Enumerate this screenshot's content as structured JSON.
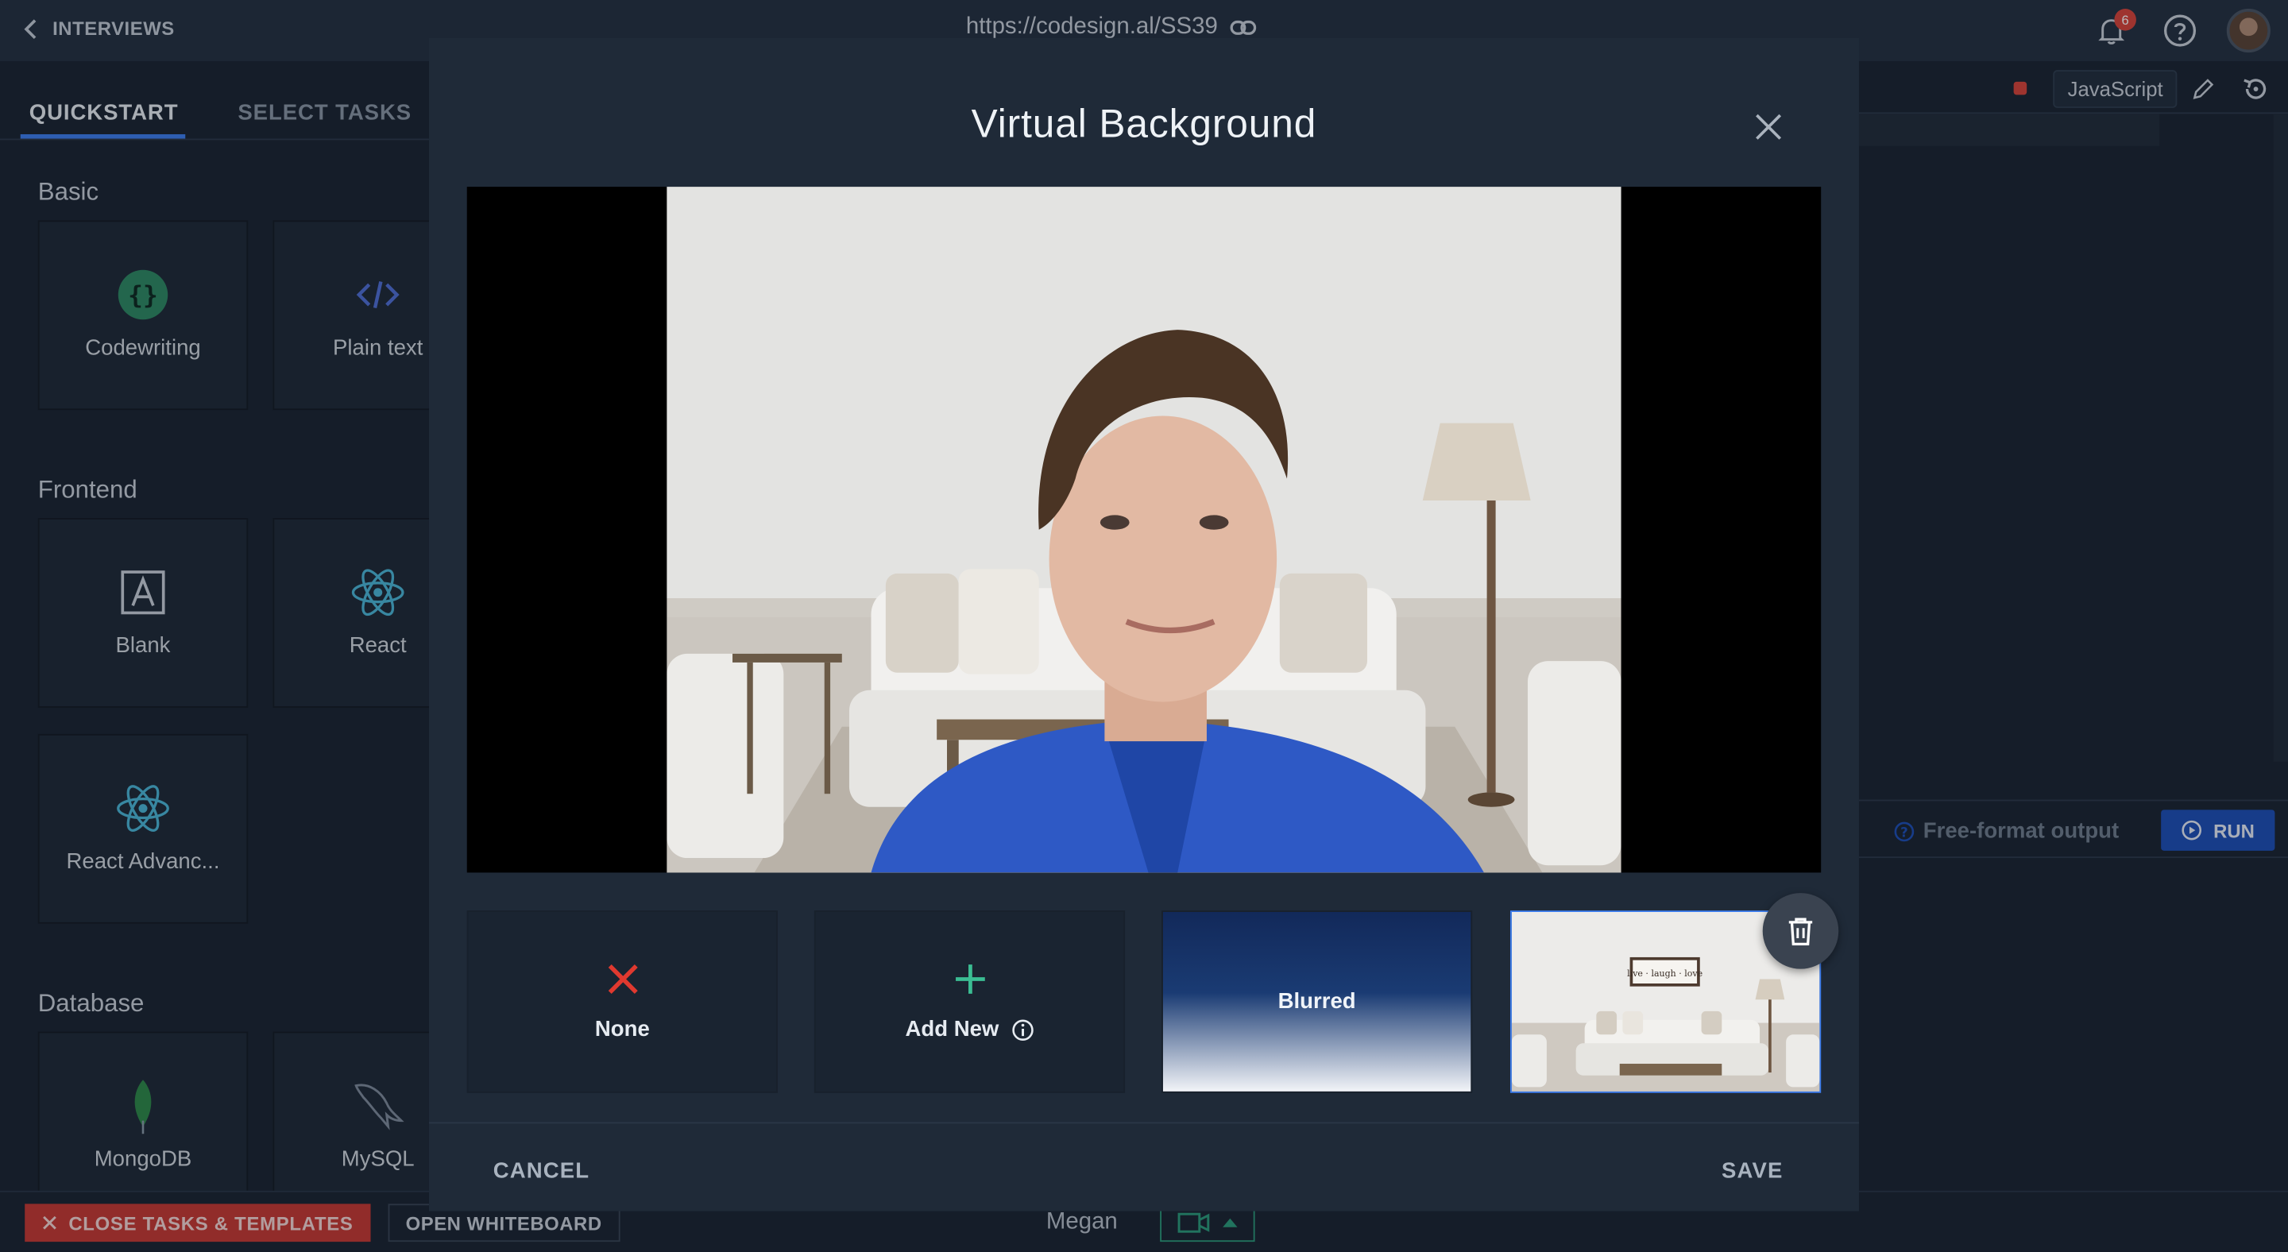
{
  "topbar": {
    "back_label": "INTERVIEWS",
    "url": "https://codesign.al/SS39",
    "notifications_count": "6"
  },
  "left_panel": {
    "tabs": [
      {
        "label": "QUICKSTART",
        "active": true
      },
      {
        "label": "SELECT TASKS",
        "active": false
      }
    ],
    "sections": [
      {
        "title": "Basic",
        "cards": [
          {
            "label": "Codewriting",
            "icon": "code-braces-icon"
          },
          {
            "label": "Plain text",
            "icon": "code-tag-icon"
          }
        ]
      },
      {
        "title": "Frontend",
        "cards": [
          {
            "label": "Blank",
            "icon": "blank-a-icon"
          },
          {
            "label": "React",
            "icon": "react-atom-icon"
          },
          {
            "label": "React Advanc...",
            "icon": "react-atom-icon"
          }
        ]
      },
      {
        "title": "Database",
        "cards": [
          {
            "label": "MongoDB",
            "icon": "mongodb-leaf-icon"
          },
          {
            "label": "MySQL",
            "icon": "mysql-dolphin-icon"
          }
        ]
      }
    ]
  },
  "right_area": {
    "language": "JavaScript",
    "output_label": "Free-format output",
    "run_label": "RUN"
  },
  "bottombar": {
    "close_label": "CLOSE TASKS & TEMPLATES",
    "whiteboard_label": "OPEN WHITEBOARD",
    "user_name": "Megan"
  },
  "modal": {
    "title": "Virtual Background",
    "options": [
      {
        "label": "None",
        "icon": "x-icon"
      },
      {
        "label": "Add New",
        "icon": "plus-icon"
      },
      {
        "label": "Blurred"
      },
      {
        "label": "",
        "sign_text": "live · laugh · love",
        "selected": true
      }
    ],
    "cancel_label": "CANCEL",
    "save_label": "SAVE"
  },
  "colors": {
    "accent_blue": "#3d7ef0",
    "danger_red": "#d9453b",
    "teal": "#2c9c7c",
    "modal_bg": "#1f2a38"
  }
}
